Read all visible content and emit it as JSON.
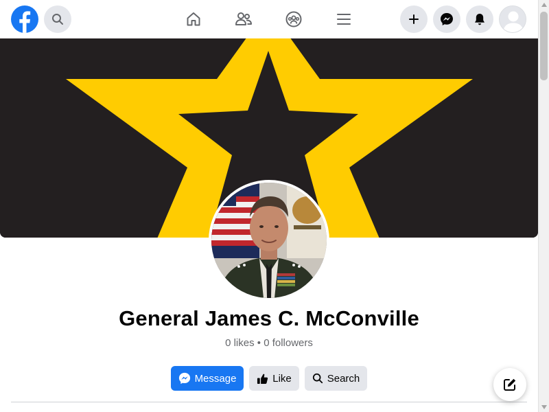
{
  "topbar": {
    "logo_icon": "facebook-logo-icon",
    "search_icon": "search-icon",
    "nav": [
      {
        "icon": "home-icon"
      },
      {
        "icon": "friends-icon"
      },
      {
        "icon": "groups-icon"
      },
      {
        "icon": "menu-icon"
      }
    ],
    "right": [
      {
        "icon": "plus-icon"
      },
      {
        "icon": "messenger-icon"
      },
      {
        "icon": "bell-icon"
      },
      {
        "icon": "account-avatar-icon"
      }
    ]
  },
  "profile": {
    "name": "General James C. McConville",
    "stats": "0 likes • 0 followers"
  },
  "actions": {
    "message_label": "Message",
    "like_label": "Like",
    "search_label": "Search"
  },
  "colors": {
    "brand": "#1877f2",
    "cover_dark": "#231f20",
    "star_gold": "#ffcc01",
    "button_gray": "#e4e6eb",
    "text_primary": "#050505",
    "text_secondary": "#65676b"
  }
}
